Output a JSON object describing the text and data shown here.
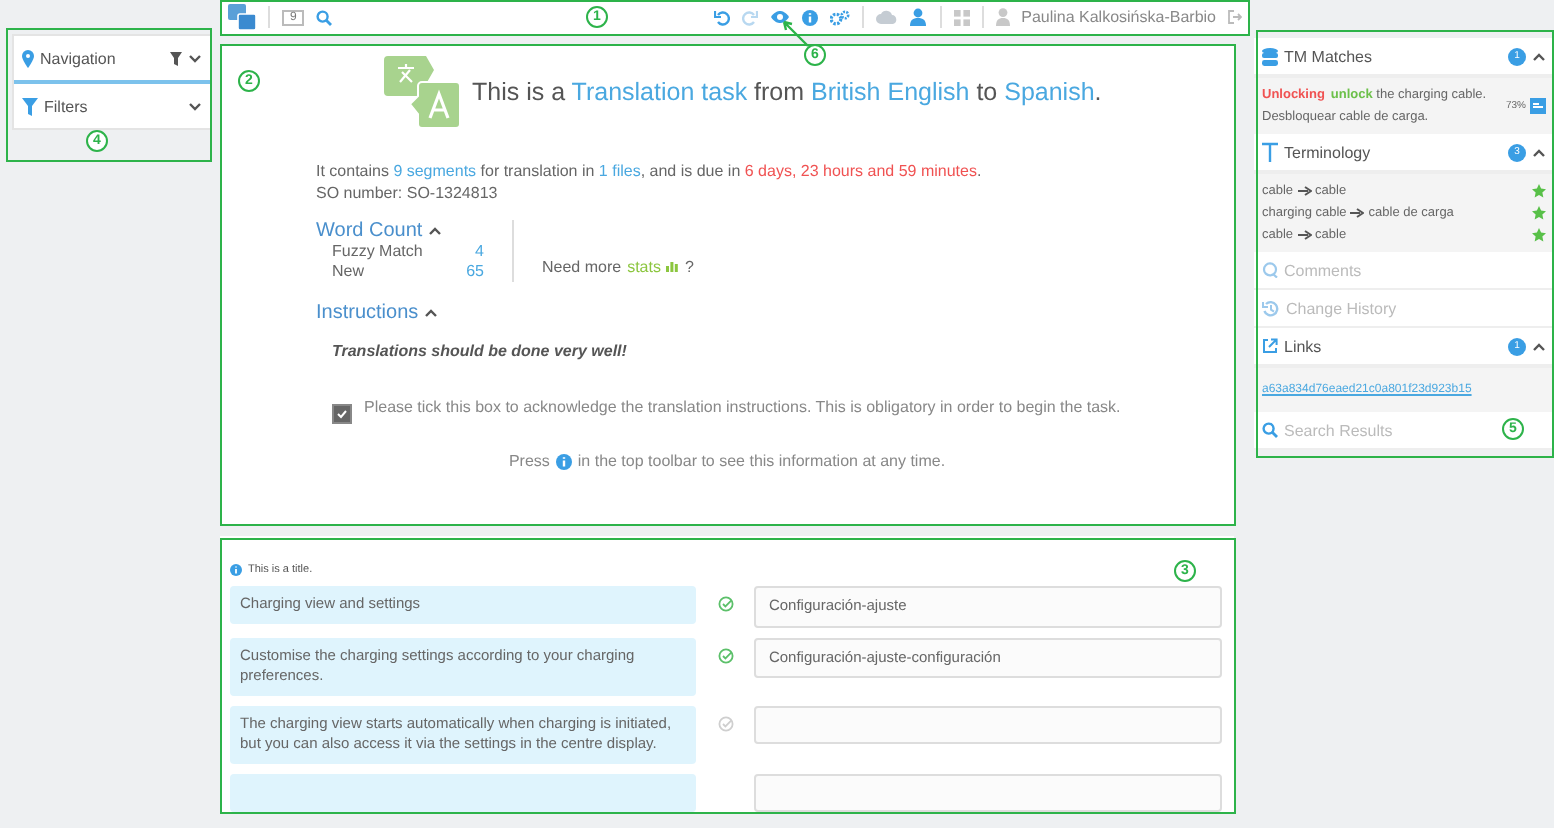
{
  "left_panel": [
    {
      "label": "Navigation",
      "kind": "navigation"
    },
    {
      "label": "Filters",
      "kind": "filters"
    }
  ],
  "toolbar": {
    "segment_count": "9",
    "user": "Paulina Kalkosińska-Barbio"
  },
  "task": {
    "title": [
      {
        "text": "This is a ",
        "kind": "plain"
      },
      {
        "text": "Translation task",
        "kind": "link"
      },
      {
        "text": " from ",
        "kind": "plain"
      },
      {
        "text": "British English",
        "kind": "link"
      },
      {
        "text": " to ",
        "kind": "plain"
      },
      {
        "text": "Spanish",
        "kind": "link"
      },
      {
        "text": ".",
        "kind": "plain"
      }
    ],
    "info": [
      {
        "text": "It contains ",
        "kind": "plain"
      },
      {
        "text": "9 segments",
        "kind": "link"
      },
      {
        "text": " for translation in ",
        "kind": "plain"
      },
      {
        "text": "1 files",
        "kind": "link"
      },
      {
        "text": ", and is due in ",
        "kind": "plain"
      },
      {
        "text": "6 days, 23 hours and 59 minutes",
        "kind": "due"
      },
      {
        "text": ".",
        "kind": "plain"
      }
    ],
    "so_number": "SO number: SO-1324813",
    "word_count": {
      "heading": "Word Count",
      "rows": [
        {
          "label": "Fuzzy Match",
          "value": "4"
        },
        {
          "label": "New",
          "value": "65"
        }
      ]
    },
    "stats": {
      "text": "Need more",
      "link": "stats",
      "help": "?"
    },
    "instructions": {
      "heading": "Instructions",
      "text": "Translations should be done very well!",
      "acknowledge": {
        "checked": true,
        "text": "Please tick this box to acknowledge the translation instructions. This is obligatory in order to begin the task."
      }
    },
    "footer": {
      "before": "Press",
      "after": "in the top toolbar to see this information at any time."
    }
  },
  "segments": {
    "title": "This is a title.",
    "rows": [
      {
        "source": "Charging view and settings",
        "confirmed": true,
        "target": "Configuración-ajuste"
      },
      {
        "source": "Customise the charging settings according to your charging preferences.",
        "confirmed": true,
        "target": "Configuración-ajuste-configuración"
      },
      {
        "source": "The charging view starts automatically when charging is initiated, but you can also access it via the settings in the centre display.",
        "confirmed": false
      },
      {}
    ]
  },
  "right_panel": [
    {
      "kind": "tm",
      "title": "TM Matches",
      "count": "1",
      "source": [
        {
          "text": "Unlocking",
          "kind": "deleted"
        },
        {
          "text": "unlock",
          "kind": "inserted"
        },
        {
          "text": " the charging cable.",
          "kind": "plain"
        }
      ],
      "score": "73%",
      "target": "Desbloquear cable de carga."
    },
    {
      "kind": "terminology",
      "title": "Terminology",
      "count": "3",
      "terms": [
        {
          "source": "cable",
          "target": "cable"
        },
        {
          "source": "charging cable",
          "target": "cable de carga"
        },
        {
          "source": "cable",
          "target": "cable"
        }
      ]
    },
    {
      "kind": "comments",
      "title": "Comments"
    },
    {
      "kind": "history",
      "title": "Change History"
    },
    {
      "kind": "links",
      "title": "Links",
      "count": "1",
      "link": "a63a834d76eaed21c0a801f23d923b15"
    },
    {
      "kind": "search",
      "title": "Search Results"
    }
  ],
  "callouts": [
    "1",
    "2",
    "3",
    "4",
    "5",
    "6"
  ]
}
